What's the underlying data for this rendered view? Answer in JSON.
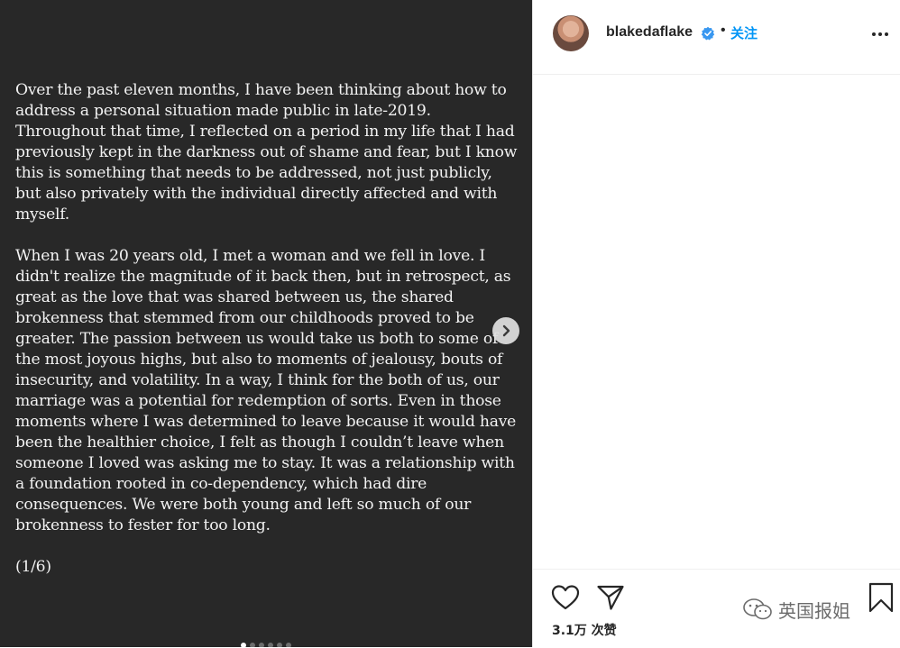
{
  "post": {
    "paragraphs": [
      "Over the past eleven months, I have been thinking about how to address a personal situation made public in late-2019. Throughout that time, I reflected on a period in my life that I had previously kept in the darkness out of shame and fear, but I know this is something that needs to be addressed, not just publicly, but also privately with the individual directly affected and with myself.",
      "When I was 20 years old, I met a woman and we fell in love. I didn't realize the magnitude of it back then, but in retrospect, as great as the love that was shared between us, the shared brokenness that stemmed from our childhoods proved to be greater. The passion between us would take us both to some of the most joyous highs, but also to moments of jealousy, bouts of insecurity, and volatility. In a way, I think for the both of us, our marriage was a potential for redemption of sorts. Even in those moments where I was determined to leave because it would have been the healthier choice, I felt as though I couldn’t leave when someone I loved was asking me to stay. It was a relationship with a foundation rooted in co-dependency, which had dire consequences. We were both young and left so much of our brokenness to fester for too long.",
      "(1/6)"
    ],
    "slide_count": 6,
    "active_slide": 1
  },
  "header": {
    "username": "blakedaflake",
    "separator": "•",
    "follow_label": "关注",
    "verified": true
  },
  "actions": {
    "likes_text": "3.1万 次赞"
  },
  "watermark": {
    "text": "英国报姐"
  },
  "colors": {
    "image_bg": "#282828",
    "text_on_image": "#f2f2f2",
    "accent": "#0095f6",
    "primary_text": "#262626"
  }
}
